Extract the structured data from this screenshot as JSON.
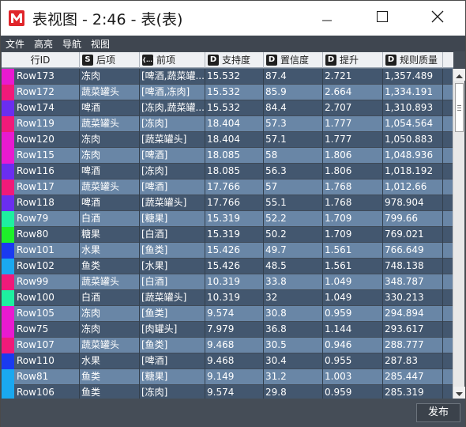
{
  "window": {
    "title": "表视图 - 2:46 - 表(表)",
    "minimize_icon": "minimize-icon",
    "maximize_icon": "maximize-icon",
    "close_icon": "close-icon",
    "app_icon": "app-logo-m"
  },
  "menu": {
    "items": [
      "文件",
      "高亮",
      "导航",
      "视图"
    ]
  },
  "table": {
    "columns": [
      {
        "label": "行ID",
        "type_icon": ""
      },
      {
        "label": "后项",
        "type_icon": "S"
      },
      {
        "label": "前项",
        "type_icon": "{...}"
      },
      {
        "label": "支持度",
        "type_icon": "D"
      },
      {
        "label": "置信度",
        "type_icon": "D"
      },
      {
        "label": "提升",
        "type_icon": "D"
      },
      {
        "label": "规则质量",
        "type_icon": "D"
      }
    ],
    "rows": [
      {
        "color": "#e81ad0",
        "id": "Row173",
        "consequent": "冻肉",
        "antecedent": "[啤酒,蔬菜罐...",
        "support": "15.532",
        "confidence": "87.4",
        "lift": "2.721",
        "quality": "1,357.489"
      },
      {
        "color": "#f01a7a",
        "id": "Row172",
        "consequent": "蔬菜罐头",
        "antecedent": "[啤酒,冻肉]",
        "support": "15.532",
        "confidence": "85.9",
        "lift": "2.664",
        "quality": "1,334.191"
      },
      {
        "color": "#6a2ef0",
        "id": "Row174",
        "consequent": "啤酒",
        "antecedent": "[冻肉,蔬菜罐...",
        "support": "15.532",
        "confidence": "84.4",
        "lift": "2.707",
        "quality": "1,310.893"
      },
      {
        "color": "#f01a7a",
        "id": "Row119",
        "consequent": "蔬菜罐头",
        "antecedent": "[冻肉]",
        "support": "18.404",
        "confidence": "57.3",
        "lift": "1.777",
        "quality": "1,054.564"
      },
      {
        "color": "#e81ad0",
        "id": "Row120",
        "consequent": "冻肉",
        "antecedent": "[蔬菜罐头]",
        "support": "18.404",
        "confidence": "57.1",
        "lift": "1.777",
        "quality": "1,050.883"
      },
      {
        "color": "#e81ad0",
        "id": "Row115",
        "consequent": "冻肉",
        "antecedent": "[啤酒]",
        "support": "18.085",
        "confidence": "58",
        "lift": "1.806",
        "quality": "1,048.936"
      },
      {
        "color": "#6a2ef0",
        "id": "Row116",
        "consequent": "啤酒",
        "antecedent": "[冻肉]",
        "support": "18.085",
        "confidence": "56.3",
        "lift": "1.806",
        "quality": "1,018.192"
      },
      {
        "color": "#f01a7a",
        "id": "Row117",
        "consequent": "蔬菜罐头",
        "antecedent": "[啤酒]",
        "support": "17.766",
        "confidence": "57",
        "lift": "1.768",
        "quality": "1,012.66"
      },
      {
        "color": "#6a2ef0",
        "id": "Row118",
        "consequent": "啤酒",
        "antecedent": "[蔬菜罐头]",
        "support": "17.766",
        "confidence": "55.1",
        "lift": "1.768",
        "quality": "978.904"
      },
      {
        "color": "#1ef0a0",
        "id": "Row79",
        "consequent": "白酒",
        "antecedent": "[糖果]",
        "support": "15.319",
        "confidence": "52.2",
        "lift": "1.709",
        "quality": "799.66"
      },
      {
        "color": "#1ef02a",
        "id": "Row80",
        "consequent": "糖果",
        "antecedent": "[白酒]",
        "support": "15.319",
        "confidence": "50.2",
        "lift": "1.709",
        "quality": "769.021"
      },
      {
        "color": "#1a3af0",
        "id": "Row101",
        "consequent": "水果",
        "antecedent": "[鱼类]",
        "support": "15.426",
        "confidence": "49.7",
        "lift": "1.561",
        "quality": "766.649"
      },
      {
        "color": "#1aa8f0",
        "id": "Row102",
        "consequent": "鱼类",
        "antecedent": "[水果]",
        "support": "15.426",
        "confidence": "48.5",
        "lift": "1.561",
        "quality": "748.138"
      },
      {
        "color": "#f01a7a",
        "id": "Row99",
        "consequent": "蔬菜罐头",
        "antecedent": "[白酒]",
        "support": "10.319",
        "confidence": "33.8",
        "lift": "1.049",
        "quality": "348.787"
      },
      {
        "color": "#1ef0a0",
        "id": "Row100",
        "consequent": "白酒",
        "antecedent": "[蔬菜罐头]",
        "support": "10.319",
        "confidence": "32",
        "lift": "1.049",
        "quality": "330.213"
      },
      {
        "color": "#e81ad0",
        "id": "Row105",
        "consequent": "冻肉",
        "antecedent": "[鱼类]",
        "support": "9.574",
        "confidence": "30.8",
        "lift": "0.959",
        "quality": "294.894"
      },
      {
        "color": "#e81ad0",
        "id": "Row75",
        "consequent": "冻肉",
        "antecedent": "[肉罐头]",
        "support": "7.979",
        "confidence": "36.8",
        "lift": "1.144",
        "quality": "293.617"
      },
      {
        "color": "#f01a7a",
        "id": "Row107",
        "consequent": "蔬菜罐头",
        "antecedent": "[鱼类]",
        "support": "9.468",
        "confidence": "30.5",
        "lift": "0.946",
        "quality": "288.777"
      },
      {
        "color": "#1a3af0",
        "id": "Row110",
        "consequent": "水果",
        "antecedent": "[啤酒]",
        "support": "9.468",
        "confidence": "30.4",
        "lift": "0.955",
        "quality": "287.83"
      },
      {
        "color": "#1aa8f0",
        "id": "Row81",
        "consequent": "鱼类",
        "antecedent": "[糖果]",
        "support": "9.149",
        "confidence": "31.2",
        "lift": "1.003",
        "quality": "285.447"
      },
      {
        "color": "#1aa8f0",
        "id": "Row106",
        "consequent": "鱼类",
        "antecedent": "[冻肉]",
        "support": "9.574",
        "confidence": "29.8",
        "lift": "0.959",
        "quality": "285.319"
      }
    ]
  },
  "scrollbar": {
    "up_icon": "scroll-up-arrow-icon",
    "down_icon": "scroll-down-arrow-icon",
    "scroll_position": 0.0
  },
  "footer": {
    "publish_label": "发布"
  }
}
